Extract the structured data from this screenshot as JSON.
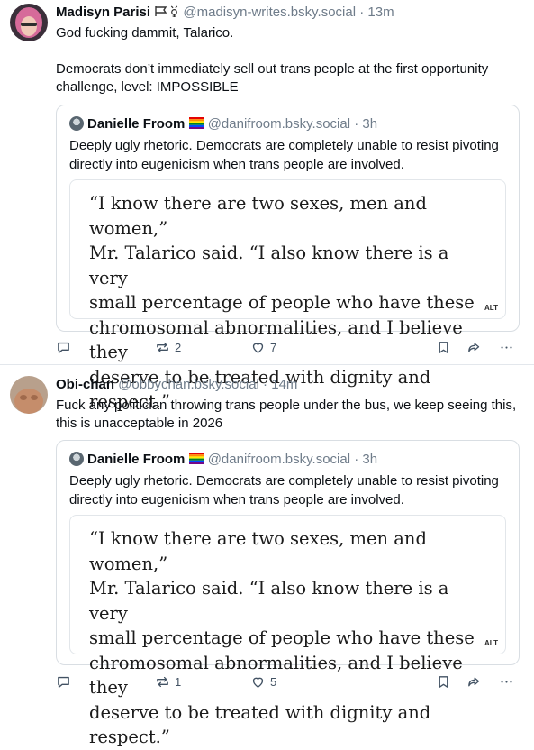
{
  "posts": [
    {
      "author_name": "Madisyn Parisi",
      "author_handle": "@madisyn-writes.bsky.social",
      "time": "13m",
      "text": "God fucking dammit, Talarico.\n\nDemocrats don’t immediately sell out trans people at the first opportunity challenge, level: IMPOSSIBLE",
      "quote": {
        "author_name": "Danielle Froom",
        "author_handle": "@danifroom.bsky.social",
        "time": "3h",
        "text": "Deeply ugly rhetoric. Democrats are completely unable to resist pivoting directly into eugenicism when trans people are involved.",
        "image_text": "“I know there are two sexes, men and women,”\nMr. Talarico said. “I also know there is a very\nsmall percentage of people who have these\nchromosomal abnormalities, and I believe they\ndeserve to be treated with dignity and respect.”",
        "image_alt_badge": "ALT"
      },
      "actions": {
        "reposts": "2",
        "likes": "7"
      }
    },
    {
      "author_name": "Obi-chan",
      "author_handle": "@obbychan.bsky.social",
      "time": "14m",
      "text": "Fuck any politician throwing trans people under the bus, we keep seeing this, this is unacceptable in 2026",
      "quote": {
        "author_name": "Danielle Froom",
        "author_handle": "@danifroom.bsky.social",
        "time": "3h",
        "text": "Deeply ugly rhetoric. Democrats are completely unable to resist pivoting directly into eugenicism when trans people are involved.",
        "image_text": "“I know there are two sexes, men and women,”\nMr. Talarico said. “I also know there is a very\nsmall percentage of people who have these\nchromosomal abnormalities, and I believe they\ndeserve to be treated with dignity and respect.”",
        "image_alt_badge": "ALT"
      },
      "actions": {
        "reposts": "1",
        "likes": "5"
      }
    }
  ],
  "separator": " · ",
  "icons": [
    "reply-icon",
    "repost-icon",
    "like-icon",
    "bookmark-icon",
    "share-icon",
    "more-icon",
    "transgender-flag-icon",
    "pride-flag-icon",
    "trans-symbol-icon"
  ],
  "colors": {
    "muted": "#6f7c8a",
    "action": "#425263",
    "border": "#d9dee3"
  }
}
